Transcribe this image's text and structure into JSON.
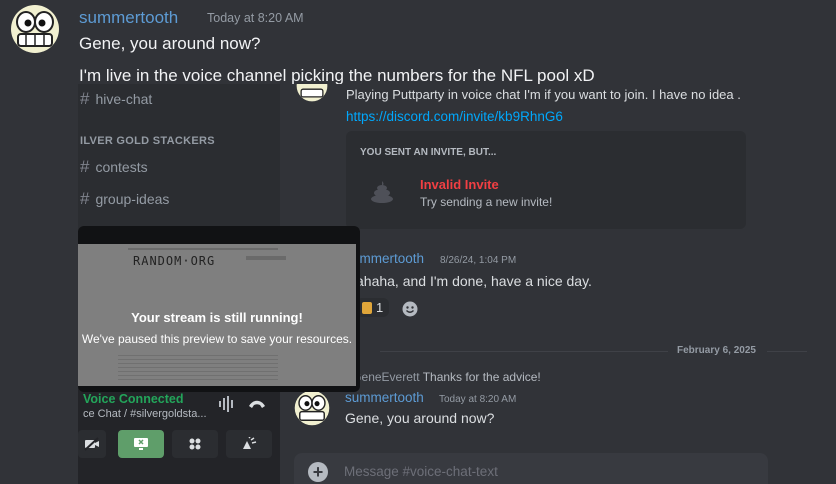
{
  "top_message": {
    "author": "summertooth",
    "timestamp": "Today at 8:20 AM",
    "lines": [
      "Gene, you around now?",
      "I'm live in the voice channel picking the numbers for the NFL pool xD"
    ]
  },
  "sidebar": {
    "channels_top": [
      {
        "label": "hive-chat"
      }
    ],
    "category": "ILVER GOLD STACKERS",
    "channels": [
      {
        "label": "contests"
      },
      {
        "label": "group-ideas"
      }
    ]
  },
  "stream": {
    "site_title": "RANDOM·ORG",
    "heading": "Your stream is still running!",
    "subtext": "We've paused this preview to save your resources."
  },
  "voice": {
    "status": "Voice Connected",
    "channel": "ce Chat / #silvergoldsta..."
  },
  "chat": {
    "partial_message": "Playing Puttparty in voice chat I'm if you want to join. I have no idea .",
    "invite_link": "https://discord.com/invite/kb9RhnG6",
    "invite_card": {
      "header": "YOU SENT AN INVITE, BUT...",
      "title": "Invalid Invite",
      "subtitle": "Try sending a new invite!"
    },
    "message2": {
      "author": "ummertooth",
      "timestamp": "8/26/24, 1:04 PM",
      "text": "ahaha, and I'm done, have a nice day.",
      "reaction_count": "1"
    },
    "date_divider": "February 6, 2025",
    "reply": {
      "mention": "@GeneEverett",
      "text": "Thanks for the advice!"
    },
    "message3": {
      "author": "summertooth",
      "timestamp": "Today at 8:20 AM",
      "text": "Gene, you around now?"
    },
    "composer_placeholder": "Message #voice-chat-text"
  },
  "colors": {
    "username": "#5d9bd4",
    "voice_connected": "#23a55a",
    "invalid_invite": "#f23f43",
    "link": "#00a8fc"
  }
}
